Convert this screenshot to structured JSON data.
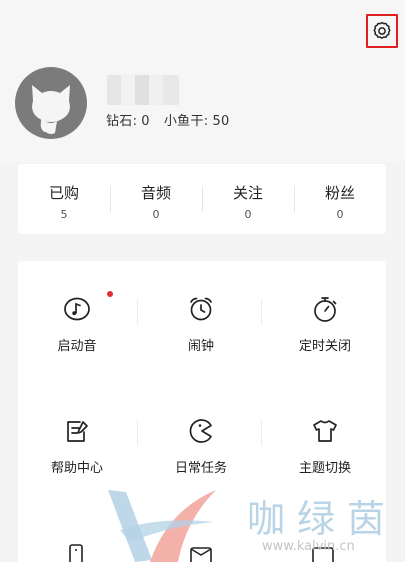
{
  "profile": {
    "balance_diamond_label": "钻石:",
    "balance_diamond_value": "0",
    "balance_fish_label": "小鱼干:",
    "balance_fish_value": "50"
  },
  "stats": [
    {
      "label": "已购",
      "value": "5"
    },
    {
      "label": "音频",
      "value": "0"
    },
    {
      "label": "关注",
      "value": "0"
    },
    {
      "label": "粉丝",
      "value": "0"
    }
  ],
  "menu": [
    {
      "label": "启动音",
      "icon": "music-note-icon"
    },
    {
      "label": "闹钟",
      "icon": "alarm-clock-icon"
    },
    {
      "label": "定时关闭",
      "icon": "timer-icon"
    },
    {
      "label": "帮助中心",
      "icon": "help-edit-icon"
    },
    {
      "label": "日常任务",
      "icon": "pacman-task-icon"
    },
    {
      "label": "主题切换",
      "icon": "tshirt-icon"
    }
  ],
  "watermark": {
    "cn": "咖绿茵",
    "url": "www.kalvin.cn"
  },
  "colors": {
    "highlight": "#e02020",
    "notification_dot": "#e03030",
    "watermark_blue": "#b9d4e6",
    "watermark_pink": "#f2a39b"
  }
}
